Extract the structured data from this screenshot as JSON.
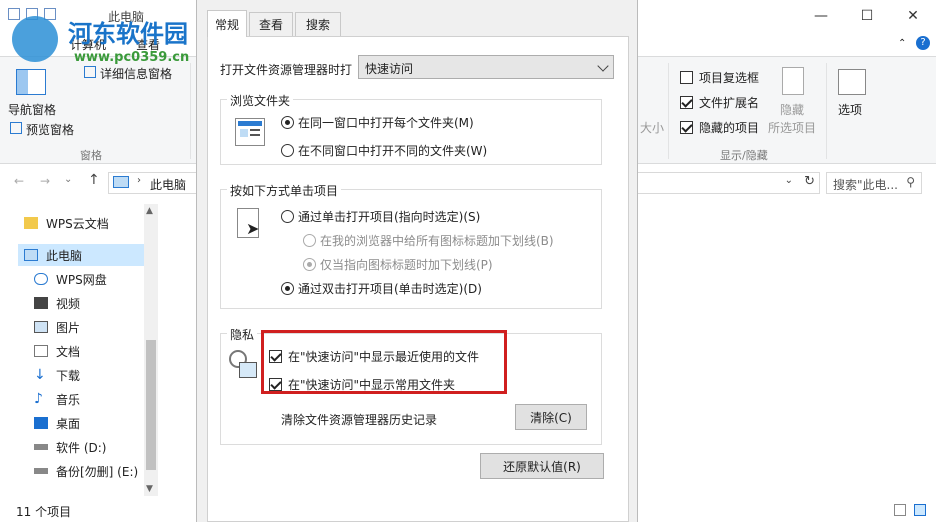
{
  "explorer": {
    "title": "此电脑",
    "ribbon_tabs": [
      "计算机",
      "查看"
    ],
    "ribbon": {
      "nav_pane": "导航窗格",
      "preview_pane": "预览窗格",
      "details_pane": "详细信息窗格",
      "pane_group": "窗格",
      "size_label": "大小",
      "item_checkbox": "项目复选框",
      "file_ext": "文件扩展名",
      "hidden_items": "隐藏的项目",
      "hide_selected_1": "隐藏",
      "hide_selected_2": "所选项目",
      "options": "选项",
      "show_hide_group": "显示/隐藏"
    },
    "address": "此电脑",
    "search_placeholder": "搜索\"此电...",
    "nav_items": [
      {
        "label": "WPS云文档",
        "icon": "folder-icon"
      },
      {
        "label": "此电脑",
        "icon": "computer-icon"
      },
      {
        "label": "WPS网盘",
        "icon": "cloud-icon"
      },
      {
        "label": "视频",
        "icon": "video-icon"
      },
      {
        "label": "图片",
        "icon": "picture-icon"
      },
      {
        "label": "文档",
        "icon": "document-icon"
      },
      {
        "label": "下载",
        "icon": "download-icon"
      },
      {
        "label": "音乐",
        "icon": "music-icon"
      },
      {
        "label": "桌面",
        "icon": "desktop-icon"
      },
      {
        "label": "软件 (D:)",
        "icon": "drive-icon"
      },
      {
        "label": "备份[勿删] (E:)",
        "icon": "drive-icon"
      }
    ],
    "status": "11 个项目",
    "watermark_title": "河东软件园",
    "watermark_url": "www.pc0359.cn"
  },
  "dialog": {
    "tabs": [
      "常规",
      "查看",
      "搜索"
    ],
    "open_label": "打开文件资源管理器时打",
    "open_value": "快速访问",
    "browse_group": "浏览文件夹",
    "browse_same": "在同一窗口中打开每个文件夹(M)",
    "browse_new": "在不同窗口中打开不同的文件夹(W)",
    "click_group": "按如下方式单击项目",
    "single_click": "通过单击打开项目(指向时选定)(S)",
    "underline_all": "在我的浏览器中给所有图标标题加下划线(B)",
    "underline_point": "仅当指向图标标题时加下划线(P)",
    "double_click": "通过双击打开项目(单击时选定)(D)",
    "privacy_group": "隐私",
    "recent_files": "在\"快速访问\"中显示最近使用的文件",
    "frequent_folders": "在\"快速访问\"中显示常用文件夹",
    "clear_label": "清除文件资源管理器历史记录",
    "clear_button": "清除(C)",
    "restore_button": "还原默认值(R)"
  }
}
